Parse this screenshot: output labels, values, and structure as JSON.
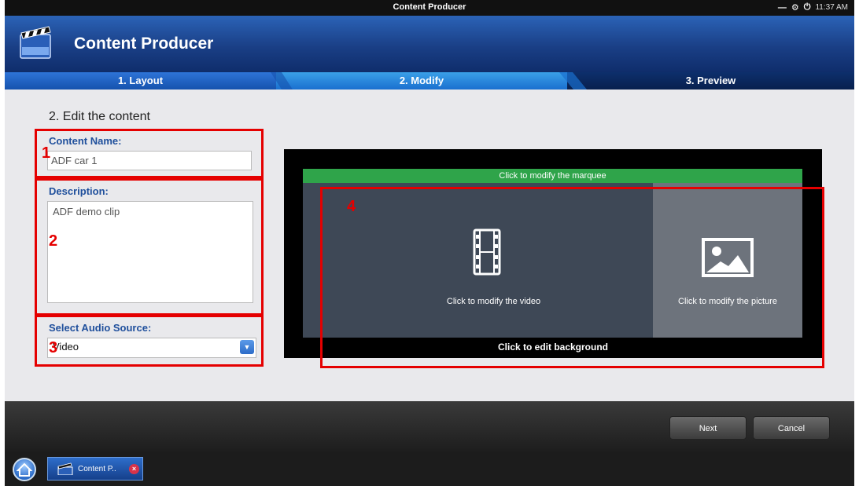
{
  "window": {
    "title": "Content Producer",
    "time": "11:37 AM"
  },
  "header": {
    "app_title": "Content Producer"
  },
  "steps": [
    {
      "label": "1. Layout"
    },
    {
      "label": "2. Modify"
    },
    {
      "label": "3. Preview"
    }
  ],
  "form": {
    "section_title": "2. Edit the content",
    "content_name_label": "Content Name:",
    "content_name_value": "ADF car 1",
    "description_label": "Description:",
    "description_value": "ADF demo clip",
    "audio_label": "Select Audio Source:",
    "audio_value": "Video"
  },
  "preview": {
    "marquee": "Click to modify the marquee",
    "video": "Click to modify the video",
    "picture": "Click to modify the picture",
    "background": "Click to edit background"
  },
  "annotations": {
    "n1": "1",
    "n2": "2",
    "n3": "3",
    "n4": "4"
  },
  "buttons": {
    "next": "Next",
    "cancel": "Cancel"
  },
  "taskbar": {
    "task_label": "Content P.."
  }
}
